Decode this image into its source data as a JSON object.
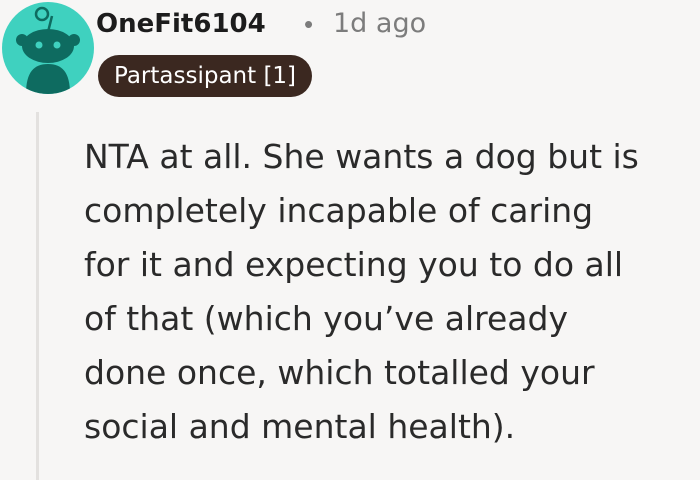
{
  "comment": {
    "author": "OneFit6104",
    "separator": "•",
    "timestamp": "1d ago",
    "flair": "Partassipant [1]",
    "avatar_icon": "reddit-snoo-avatar-icon",
    "colors": {
      "avatar_bg": "#3fd1bf",
      "flair_bg": "#3b2820",
      "flair_text": "#ffffff",
      "meta_text": "#7c7c7c",
      "thread_line": "#e3e1df"
    },
    "body_lines": [
      "NTA at all. She wants a dog but is",
      "completely incapable of caring",
      "for it and expecting you to do all",
      "of that (which you’ve already",
      "done once, which totalled your",
      "social and mental health)."
    ]
  }
}
